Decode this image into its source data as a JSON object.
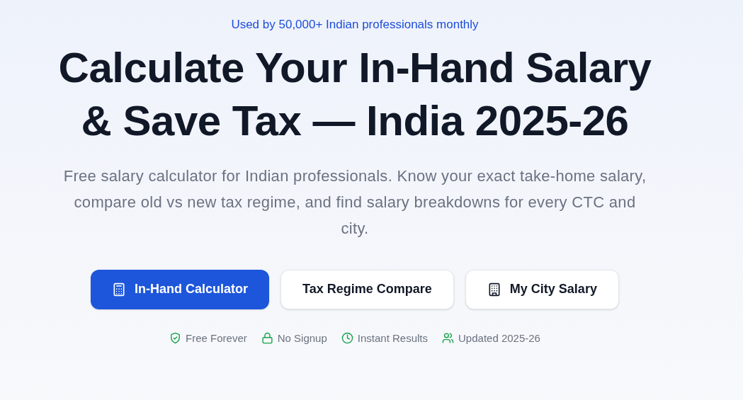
{
  "tagline": "Used by 50,000+ Indian professionals monthly",
  "headline": [
    "Calculate Your In-Hand Salary",
    "& Save Tax — India 2025-26"
  ],
  "description": "Free salary calculator for Indian professionals. Know your exact take-home salary, compare old vs new tax regime, and find salary breakdowns for every CTC and city.",
  "buttons": [
    {
      "label": "In-Hand Calculator",
      "kind": "primary"
    },
    {
      "label": "Tax Regime Compare",
      "kind": "secondary"
    },
    {
      "label": "My City Salary",
      "kind": "secondary"
    }
  ],
  "features": [
    {
      "label": "Free Forever"
    },
    {
      "label": "No Signup"
    },
    {
      "label": "Instant Results"
    },
    {
      "label": "Updated 2025-26"
    }
  ]
}
